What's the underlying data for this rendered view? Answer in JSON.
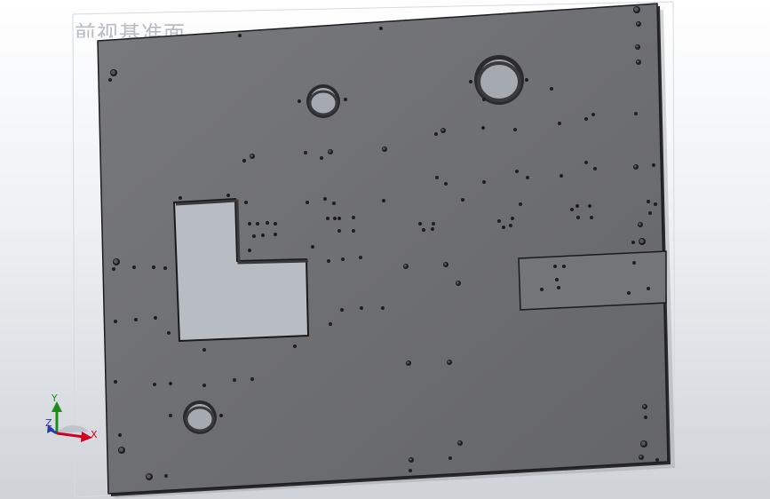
{
  "view": {
    "label": "前视基准面"
  },
  "triad": {
    "x_label": "X",
    "y_label": "Y",
    "z_label": "Z"
  },
  "colors": {
    "plate": "#6f7073",
    "plate_edge": "#1d1d1f",
    "cutout": "#b8bdc3",
    "background_top": "#ffffff",
    "background_bottom": "#cfd3d8",
    "axis_x": "#d1001f",
    "axis_y": "#1c8c1c",
    "axis_z": "#2a3aa8"
  }
}
